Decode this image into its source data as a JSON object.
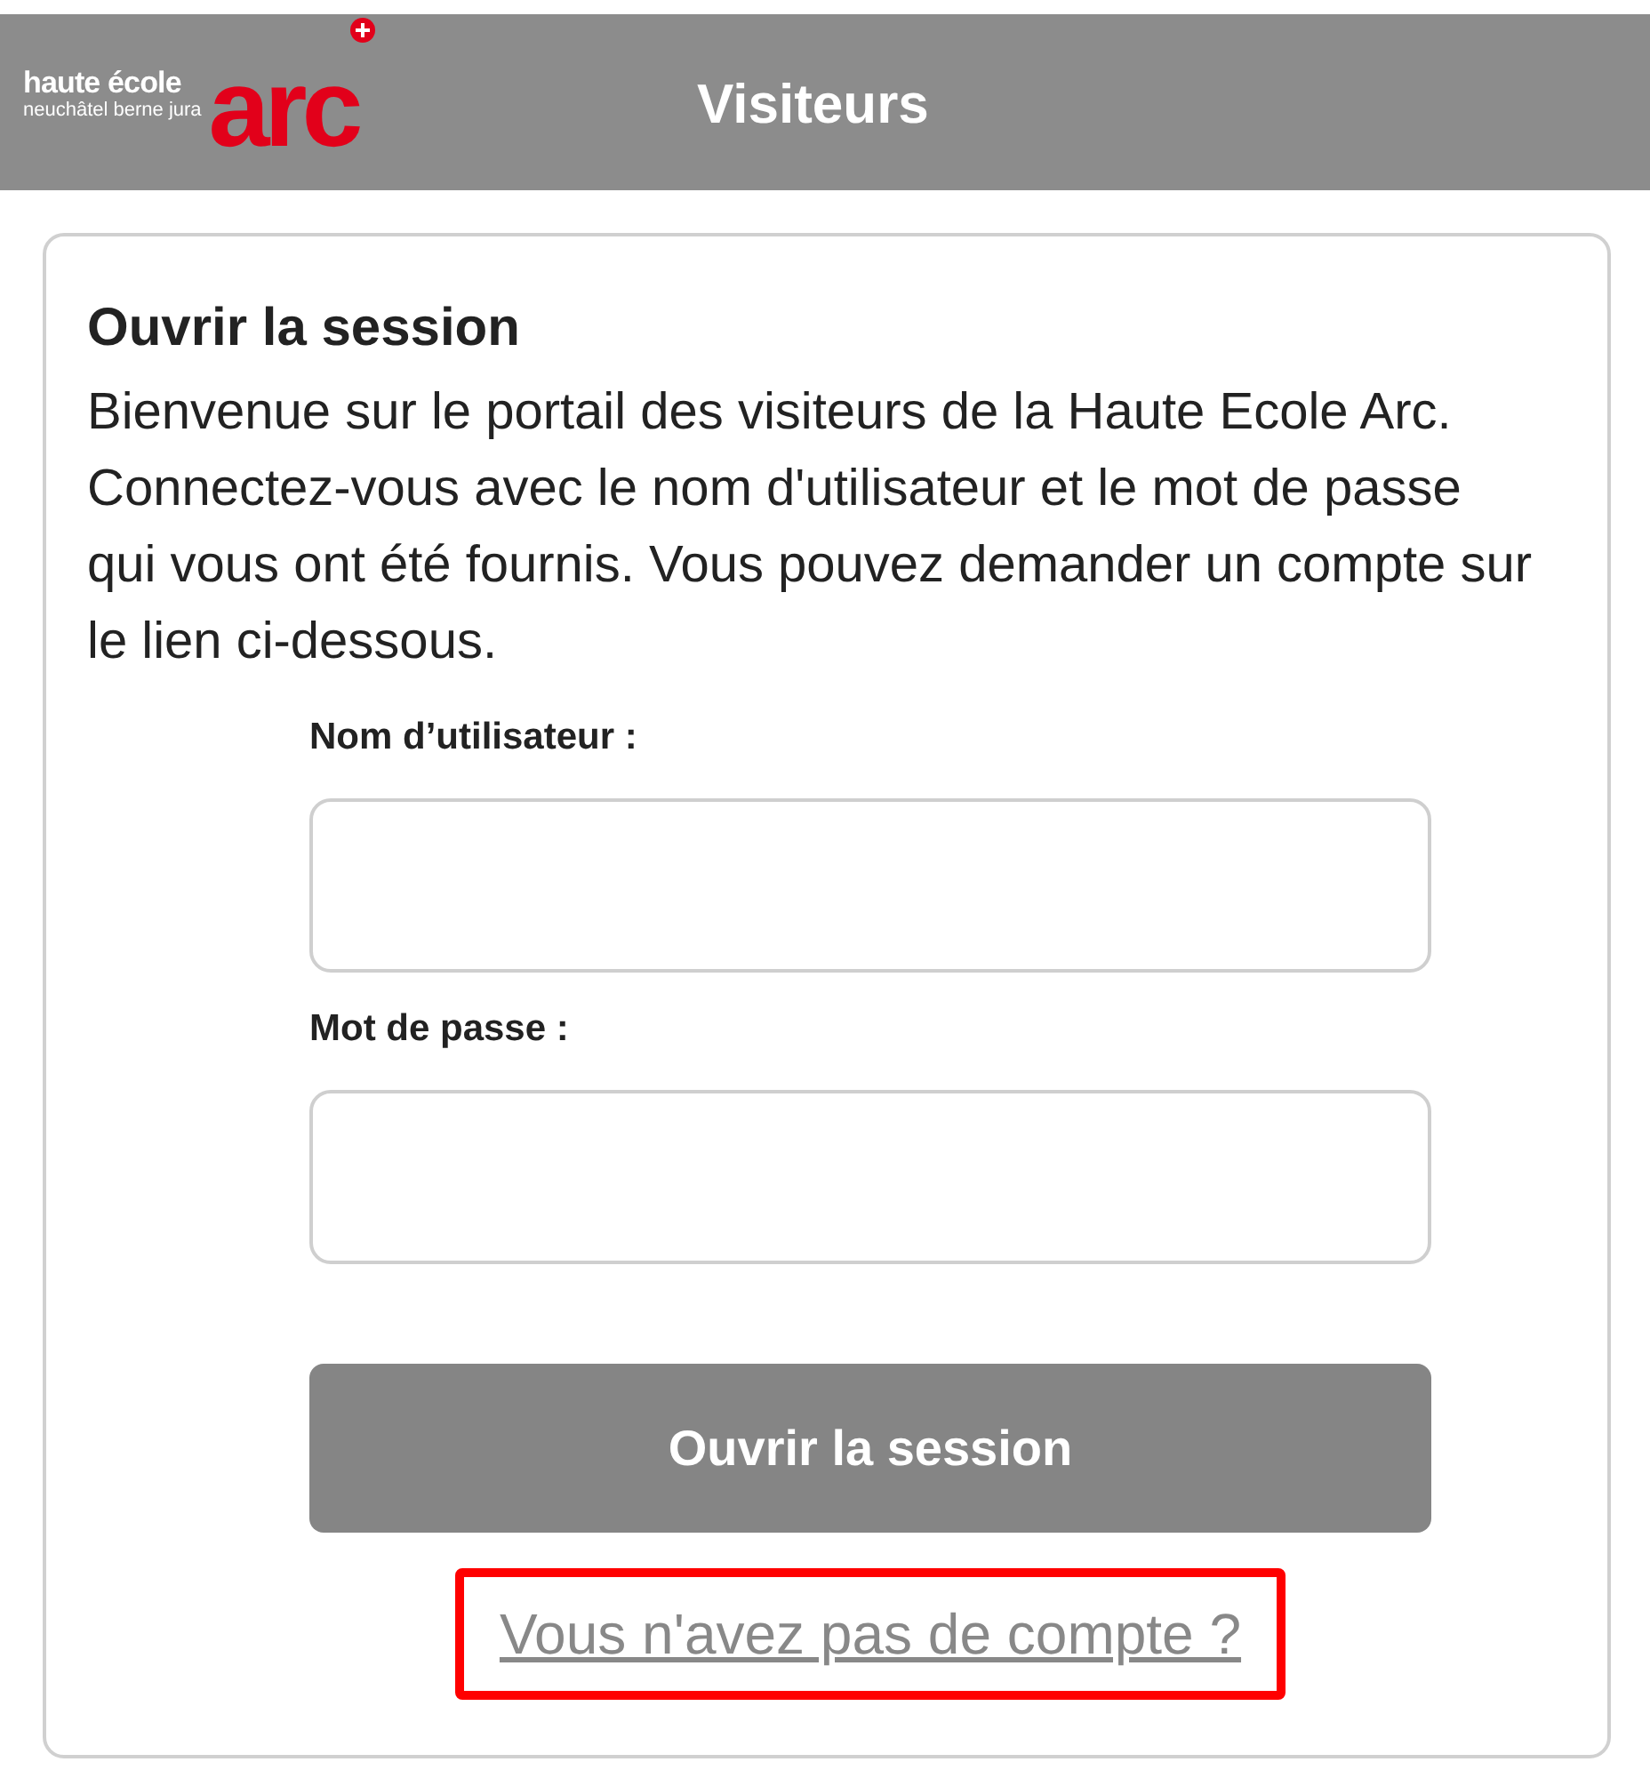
{
  "header": {
    "logo": {
      "line_1": "haute école",
      "line_2": "neuchâtel berne jura",
      "mark": "arc"
    },
    "title": "Visiteurs"
  },
  "card": {
    "title": "Ouvrir la session",
    "intro": "Bienvenue sur le portail des visiteurs de la Haute Ecole Arc. Connectez-vous avec le nom d'utilisateur et le mot de passe qui vous ont été fournis. Vous pouvez demander un compte sur le lien ci-dessous.",
    "fields": [
      {
        "label": "Nom d’utilisateur :"
      },
      {
        "label": "Mot de passe :"
      }
    ],
    "button": "Ouvrir la session",
    "link": {
      "text": "Vous n'avez pas de compte ?",
      "highlighted": true
    }
  }
}
